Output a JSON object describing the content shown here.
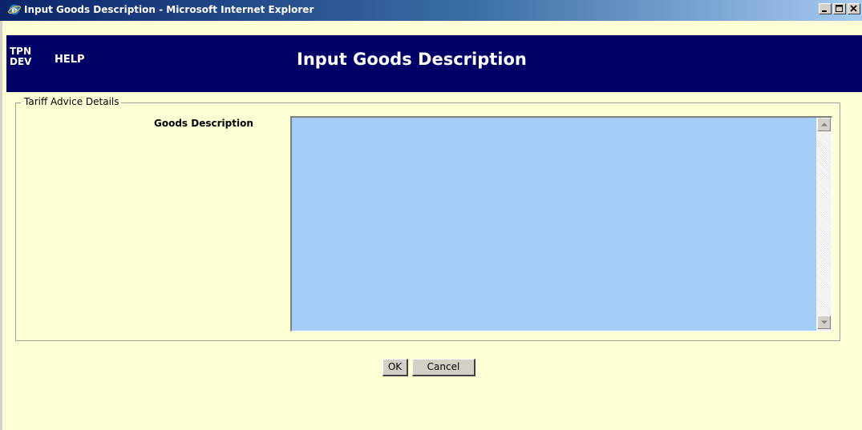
{
  "window": {
    "title": "Input Goods Description - Microsoft Internet Explorer",
    "icon": "internet-explorer-icon",
    "controls": [
      "minimize-icon",
      "maximize-icon",
      "close-icon"
    ]
  },
  "header": {
    "env_line1": "TPN",
    "env_line2": "DEV",
    "help_label": "HELP",
    "page_title": "Input Goods Description"
  },
  "form": {
    "legend": "Tariff Advice Details",
    "goods_description_label": "Goods Description",
    "goods_description_value": ""
  },
  "actions": {
    "ok_label": "OK",
    "cancel_label": "Cancel"
  },
  "colors": {
    "header_bg": "#000066",
    "page_bg": "#ffffd6",
    "textarea_bg": "#a4cdf5"
  }
}
